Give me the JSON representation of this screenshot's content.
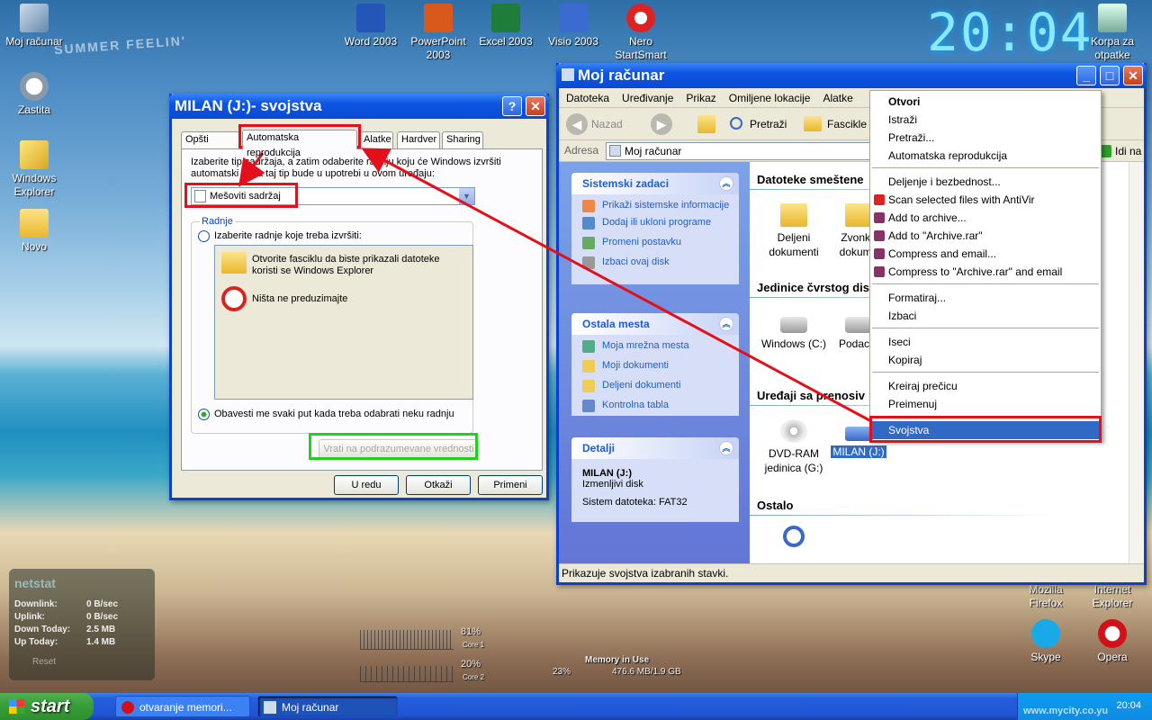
{
  "desktop": {
    "icons": [
      {
        "label": "Moj računar",
        "icon": "computer-icon"
      },
      {
        "label": "Zastita",
        "icon": "clock-icon"
      },
      {
        "label": "Windows Explorer",
        "icon": "explorer-icon"
      },
      {
        "label": "Novo",
        "icon": "folder-icon"
      },
      {
        "label": "Word 2003",
        "icon": "word-icon"
      },
      {
        "label": "PowerPoint 2003",
        "icon": "powerpoint-icon"
      },
      {
        "label": "Excel 2003",
        "icon": "excel-icon"
      },
      {
        "label": "Visio 2003",
        "icon": "visio-icon"
      },
      {
        "label": "Nero StartSmart",
        "icon": "nero-icon"
      },
      {
        "label": "Korpa za otpatke",
        "icon": "recycle-bin-icon"
      },
      {
        "label": "Mozilla Firefox",
        "icon": "firefox-icon"
      },
      {
        "label": "Internet Explorer",
        "icon": "ie-icon"
      },
      {
        "label": "Skype",
        "icon": "skype-icon"
      },
      {
        "label": "Opera",
        "icon": "opera-icon"
      }
    ],
    "clock": "20:04",
    "wallpaper_text": "SUMMER FEELIN'",
    "netstat": {
      "title": "netstat",
      "rows": [
        {
          "label": "Downlink:",
          "value": "0 B/sec"
        },
        {
          "label": "Uplink:",
          "value": "0 B/sec"
        },
        {
          "label": "Down Today:",
          "value": "2.5 MB"
        },
        {
          "label": "Up Today:",
          "value": "1.4 MB"
        }
      ],
      "reset": "Reset"
    },
    "cpu": {
      "core1": "81%",
      "core1_label": "Core 1",
      "core2": "20%",
      "core2_label": "Core 2"
    },
    "memory": {
      "label": "Memory in Use",
      "percent": "23%",
      "value": "476.6 MB/1.9 GB"
    },
    "watermark": "www.mycity.co.yu"
  },
  "props": {
    "title": "MILAN (J:)- svojstva",
    "help": "?",
    "close": "✕",
    "tabs": [
      "Opšti podaci",
      "Automatska reprodukcija",
      "Alatke",
      "Hardver",
      "Sharing"
    ],
    "intro": "Izaberite tip sadržaja, a zatim odaberite radnju koju će Windows izvršiti automatski kada taj tip bude u upotrebi u ovom uređaju:",
    "content_type": "Mešoviti sadržaj",
    "group_label": "Radnje",
    "option1": "Izaberite radnje koje treba izvršiti:",
    "actions": [
      {
        "label": "Otvorite fasciklu da biste prikazali datoteke koristi se Windows Explorer",
        "icon": "folder-open-icon"
      },
      {
        "label": "Ništa ne preduzimajte",
        "icon": "no-action-icon"
      }
    ],
    "option2": "Obavesti me svaki put kada treba odabrati neku radnju",
    "defaults_button": "Vrati na podrazumevane vrednosti",
    "ok": "U redu",
    "cancel": "Otkaži",
    "apply": "Primeni"
  },
  "explorer": {
    "title": "Moj računar",
    "menu": [
      "Datoteka",
      "Uređivanje",
      "Prikaz",
      "Omiljene lokacije",
      "Alatke"
    ],
    "toolbar": {
      "back": "Nazad",
      "search": "Pretraži",
      "folders": "Fascikle"
    },
    "address_label": "Adresa",
    "address_value": "Moj računar",
    "go": "Idi na",
    "tasks": {
      "title": "Sistemski zadaci",
      "items": [
        "Prikaži sistemske informacije",
        "Dodaj ili ukloni programe",
        "Promeni postavku",
        "Izbaci ovaj disk"
      ]
    },
    "places": {
      "title": "Ostala mesta",
      "items": [
        "Moja mrežna mesta",
        "Moji dokumenti",
        "Deljeni dokumenti",
        "Kontrolna tabla"
      ]
    },
    "details": {
      "title": "Detalji",
      "name": "MILAN (J:)",
      "type": "Izmenljivi disk",
      "fs": "Sistem datoteka: FAT32"
    },
    "sections": [
      {
        "title": "Datoteke smeštene",
        "items": [
          "Deljeni dokumenti",
          "Zvonko dokume"
        ]
      },
      {
        "title": "Jedinice čvrstog dis",
        "items": [
          "Windows (C:)",
          "Podaci ("
        ]
      },
      {
        "title": "Uređaji sa prenosiv",
        "items": [
          "DVD-RAM jedinica (G:)",
          "MILAN (J:)"
        ]
      },
      {
        "title": "Ostalo",
        "items": []
      }
    ],
    "status": "Prikazuje svojstva izabranih stavki."
  },
  "context_menu": {
    "items": [
      "Otvori",
      "Istraži",
      "Pretraži...",
      "Automatska reprodukcija",
      "Deljenje i bezbednost...",
      "Scan selected files with AntiVir",
      "Add to archive...",
      "Add to \"Archive.rar\"",
      "Compress and email...",
      "Compress to \"Archive.rar\" and email",
      "Formatiraj...",
      "Izbaci",
      "Iseci",
      "Kopiraj",
      "Kreiraj prečicu",
      "Preimenuj",
      "Svojstva"
    ]
  },
  "taskbar": {
    "start": "start",
    "items": [
      "otvaranje memori...",
      "Moj računar"
    ],
    "time": "20:04"
  },
  "colors": {
    "xp_blue": "#0a4ad1",
    "highlight": "#316ac5",
    "annotation_red": "#e3101c",
    "annotation_green": "#1fd21f"
  }
}
